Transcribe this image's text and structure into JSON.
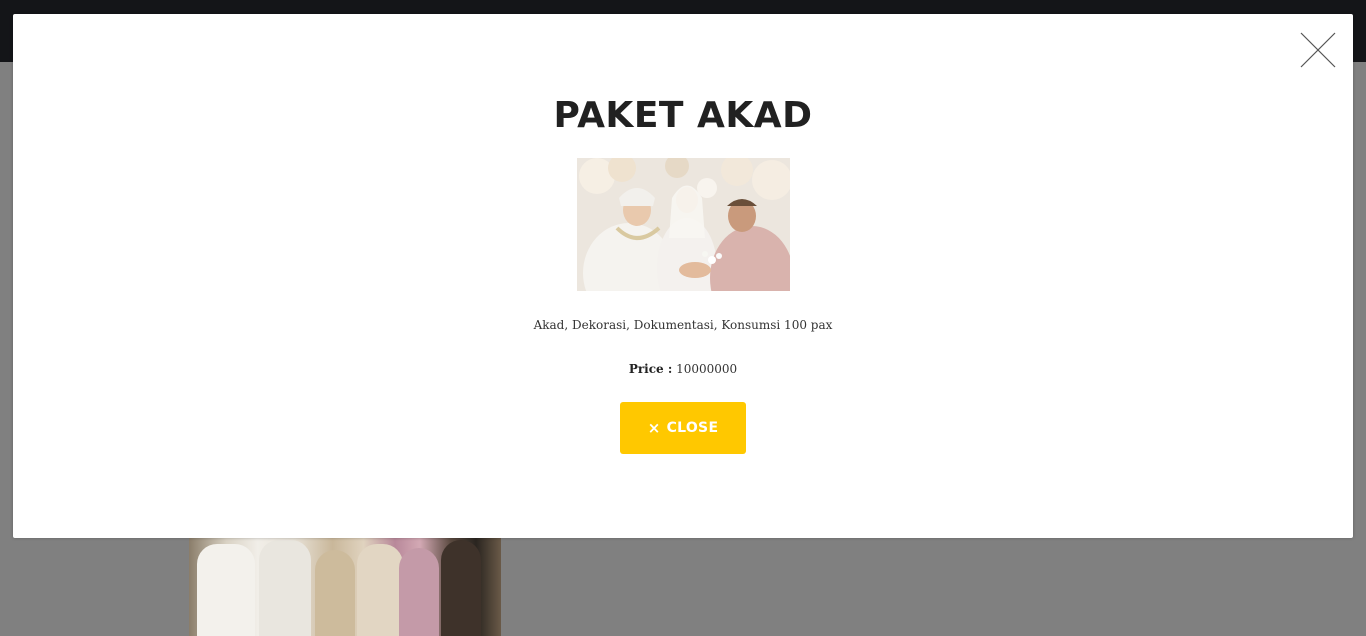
{
  "modal": {
    "title": "PAKET AKAD",
    "description": "Akad, Dekorasi, Dokumentasi, Konsumsi 100 pax",
    "price_label": "Price :",
    "price_value": "10000000",
    "close_button_label": "CLOSE",
    "close_button_icon": "×",
    "dismiss_icon": "close-icon"
  },
  "colors": {
    "accent": "#ffc800",
    "backdrop": "#808080",
    "topbar": "#141518",
    "title": "#212121"
  }
}
